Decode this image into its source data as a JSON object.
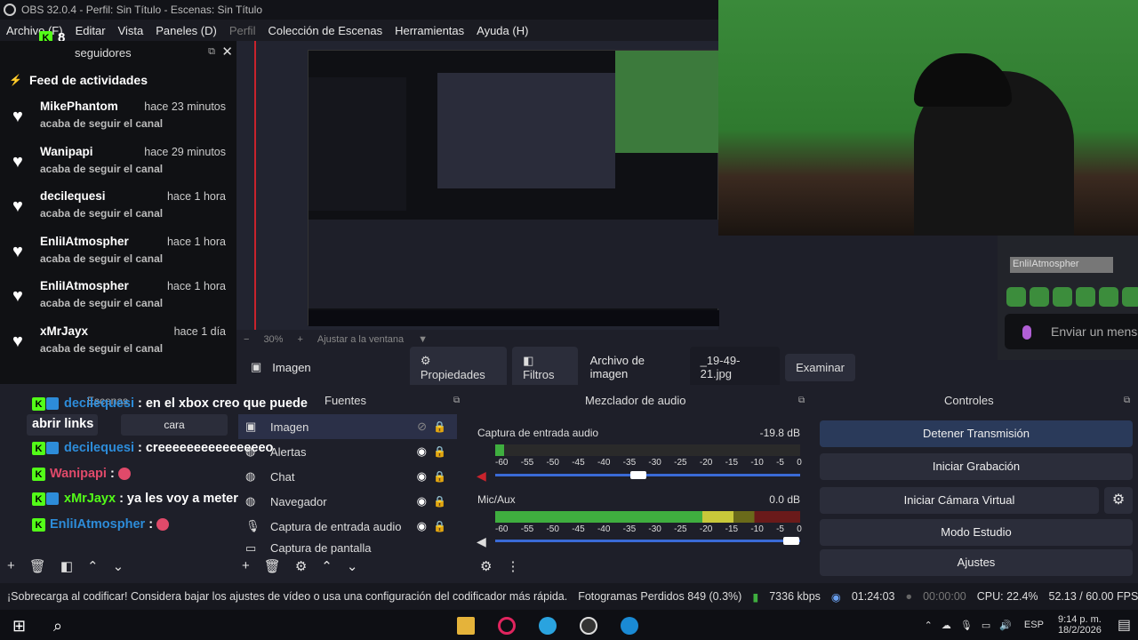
{
  "window": {
    "title": "OBS 32.0.4 - Perfil: Sin Título - Escenas: Sin Título"
  },
  "menu": [
    "Archivo (F)",
    "Editar",
    "Vista",
    "Paneles (D)",
    "Perfil",
    "Colección de Escenas",
    "Herramientas",
    "Ayuda (H)"
  ],
  "kick_badge_count": "8",
  "feed": {
    "header": "seguidores",
    "title": "Feed de actividades",
    "items": [
      {
        "name": "MikePhantom",
        "time": "hace 23 minutos",
        "desc": "acaba de seguir el canal"
      },
      {
        "name": "Wanipapi",
        "time": "hace 29 minutos",
        "desc": "acaba de seguir el canal"
      },
      {
        "name": "decilequesi",
        "time": "hace 1 hora",
        "desc": "acaba de seguir el canal"
      },
      {
        "name": "EnliIAtmospher",
        "time": "hace 1 hora",
        "desc": "acaba de seguir el canal"
      },
      {
        "name": "EnliIAtmospher",
        "time": "hace 1 hora",
        "desc": "acaba de seguir el canal"
      },
      {
        "name": "xMrJayx",
        "time": "hace 1 día",
        "desc": "acaba de seguir el canal"
      }
    ]
  },
  "overlay_chat": {
    "username": "EnliIAtmospher",
    "send_placeholder": "Enviar un mensa"
  },
  "zoom": {
    "percent": "30%",
    "fit": "Ajustar a la ventana"
  },
  "props_bar": {
    "source": "Imagen",
    "properties": "Propiedades",
    "filters": "Filtros",
    "label": "Archivo de imagen",
    "file": "_19-49-21.jpg",
    "browse": "Examinar"
  },
  "chat": {
    "messages": [
      {
        "user": "decilequesi",
        "text": ": en el xbox creo que puede"
      },
      {
        "user": "abrir links",
        "text": "cara"
      },
      {
        "user": "decilequesi",
        "text": ": creeeeeeeeeeeeeeeo"
      },
      {
        "user": "Wanipapi",
        "text": ":"
      },
      {
        "user": "xMrJayx",
        "text": ": ya les voy a meter"
      },
      {
        "user": "EnliIAtmospher",
        "text": ":"
      }
    ],
    "scenes_title": "Escenas"
  },
  "sources": {
    "title": "Fuentes",
    "items": [
      "Imagen",
      "Alertas",
      "Chat",
      "Navegador",
      "Captura de entrada audio",
      "Captura de pantalla"
    ]
  },
  "mixer": {
    "title": "Mezclador de audio",
    "channels": [
      {
        "name": "Captura de entrada audio",
        "db": "-19.8 dB",
        "level": 0.03,
        "fader": 0.47
      },
      {
        "name": "Mic/Aux",
        "db": "0.0 dB",
        "level": 0.78,
        "fader": 0.97
      }
    ],
    "scale": [
      "-60",
      "-55",
      "-50",
      "-45",
      "-40",
      "-35",
      "-30",
      "-25",
      "-20",
      "-15",
      "-10",
      "-5",
      "0"
    ]
  },
  "controls": {
    "title": "Controles",
    "buttons": [
      "Detener Transmisión",
      "Iniciar Grabación",
      "Iniciar Cámara Virtual",
      "Modo Estudio",
      "Ajustes"
    ]
  },
  "status": {
    "warning": "¡Sobrecarga al codificar! Considera bajar los ajustes de vídeo o usa una configuración del codificador más rápida.",
    "dropped": "Fotogramas Perdidos 849 (0.3%)",
    "bitrate": "7336 kbps",
    "stream_time": "01:24:03",
    "rec_time": "00:00:00",
    "cpu": "CPU: 22.4%",
    "fps": "52.13 / 60.00 FPS"
  },
  "taskbar": {
    "lang": "ESP",
    "time": "9:14 p. m.",
    "date": "18/2/2026"
  }
}
